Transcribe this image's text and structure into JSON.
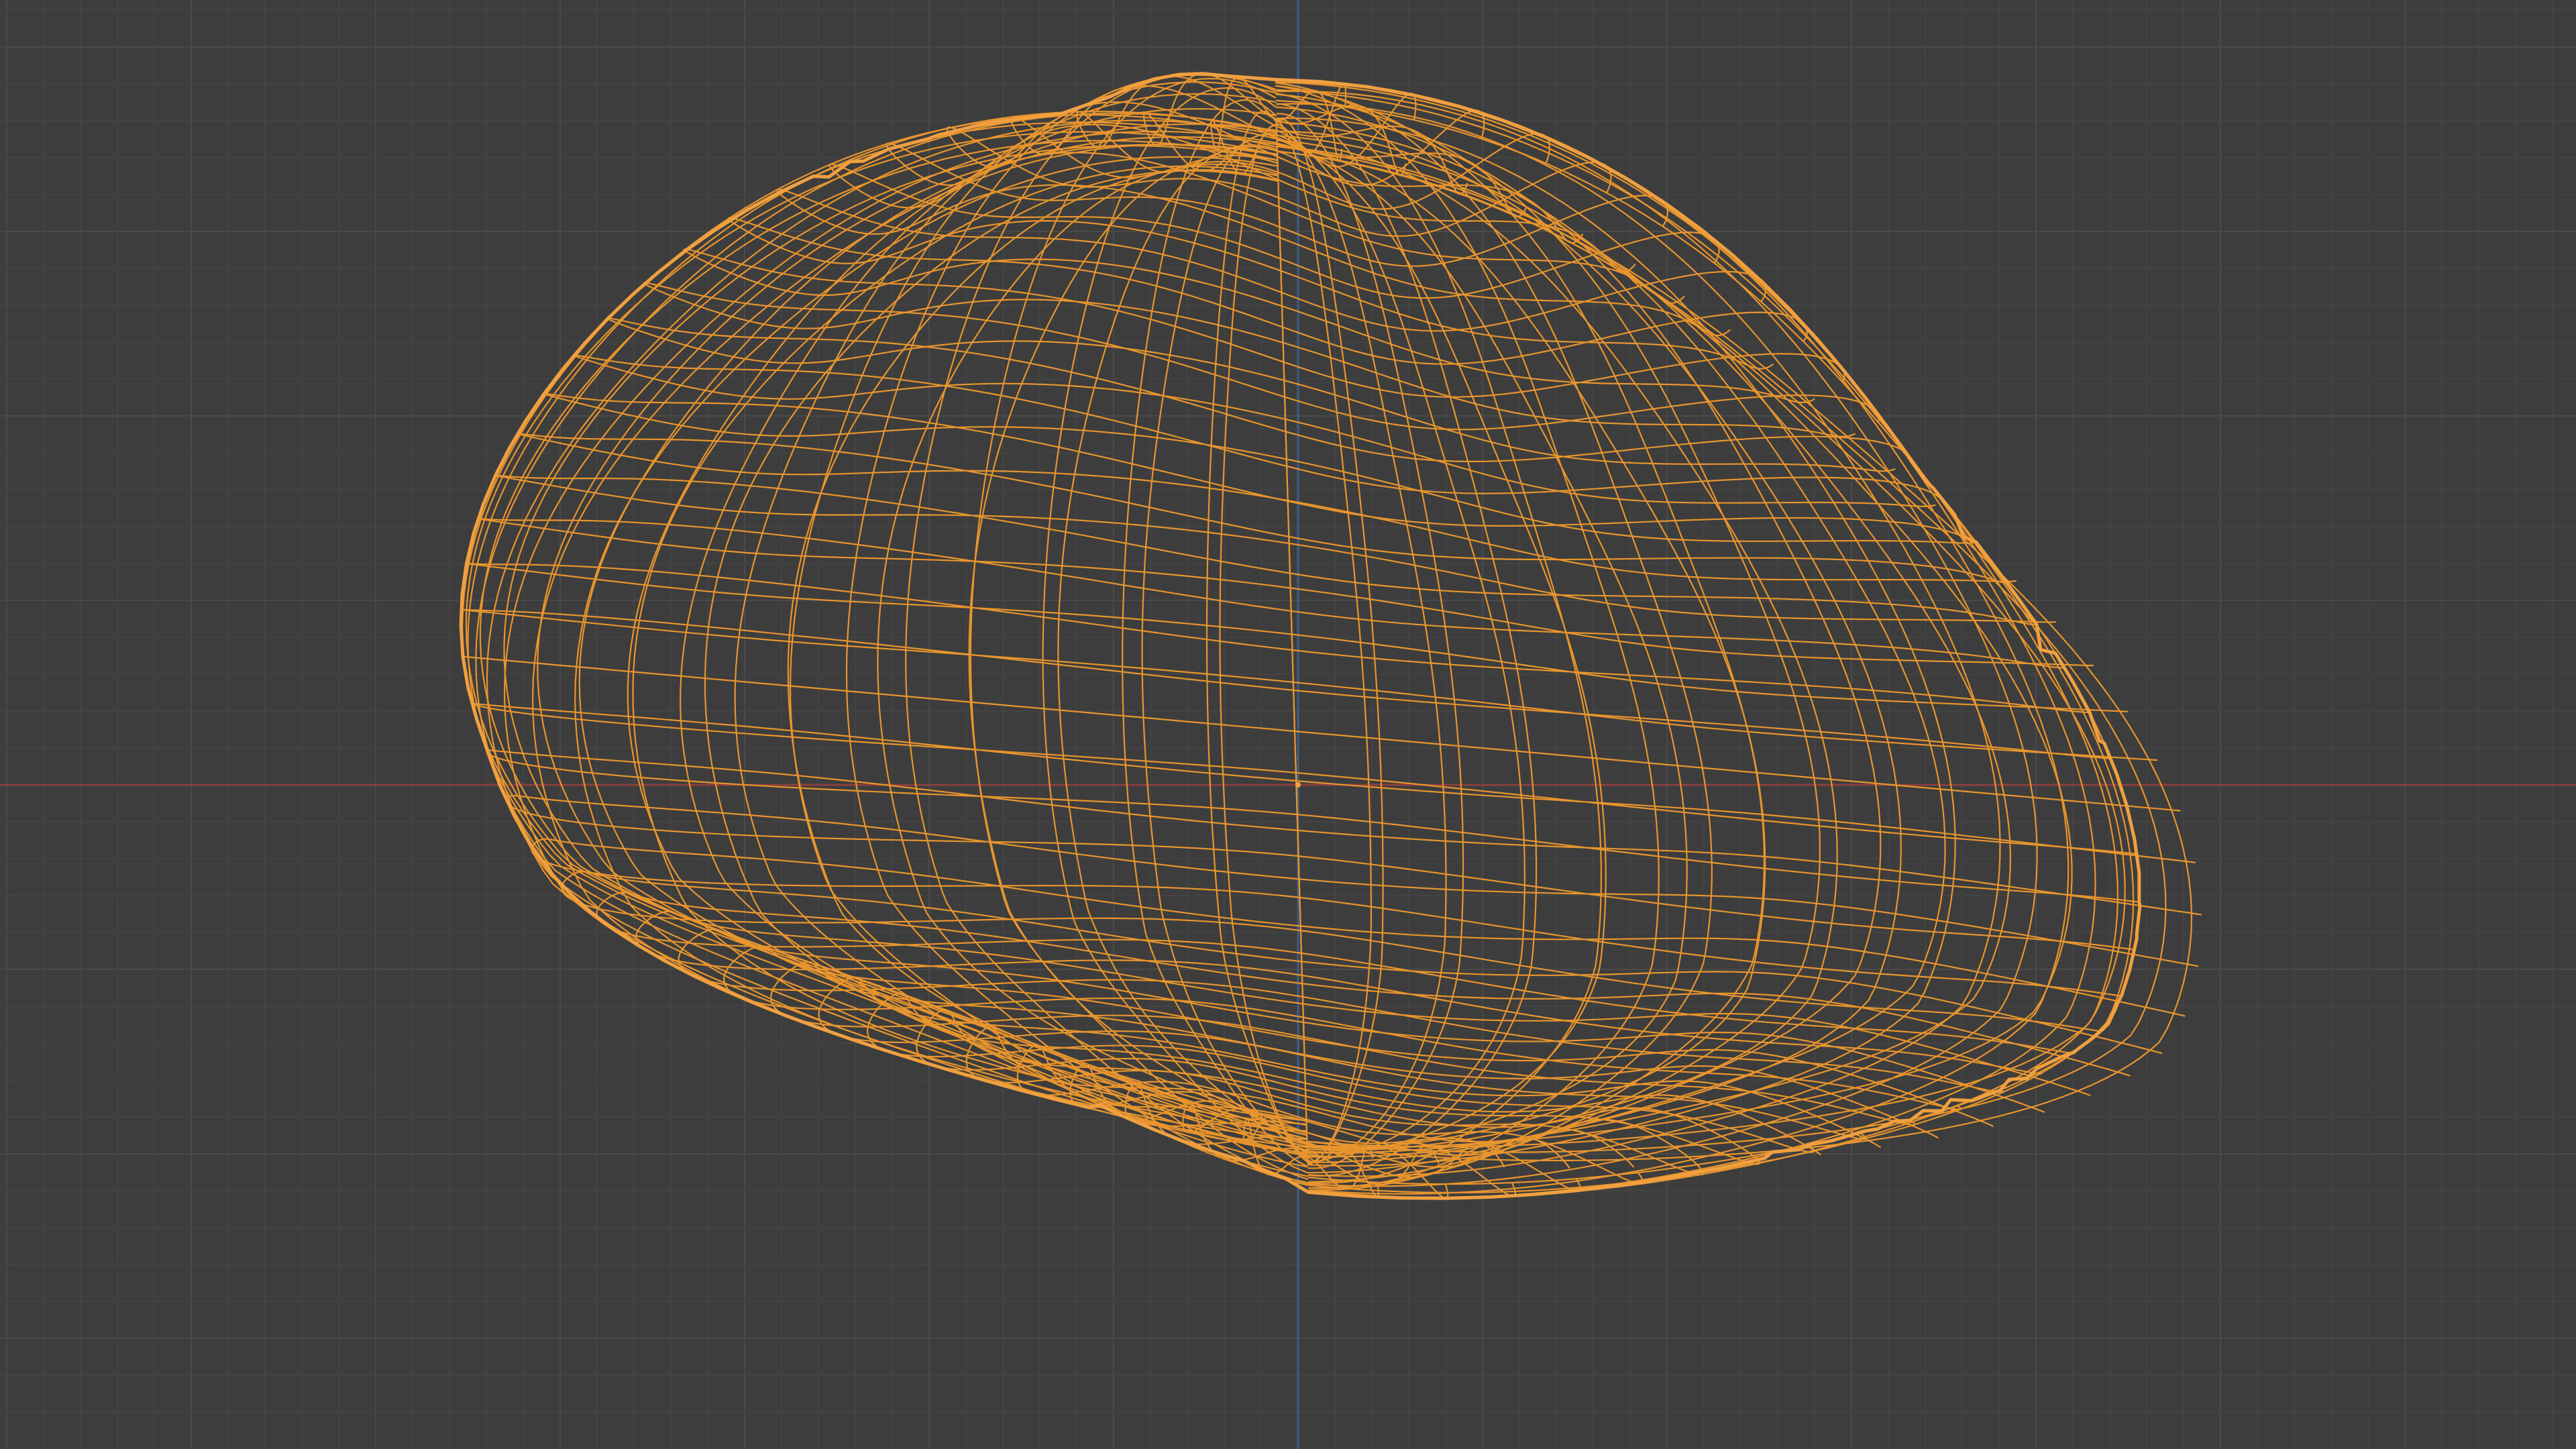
{
  "viewport": {
    "type": "3d-viewport",
    "view": "front-orthographic",
    "shading": "wireframe",
    "selection_state": "object selected",
    "colors": {
      "background": "#3d3d3d",
      "grid_minor": "#434343",
      "grid_major": "#4a4a4a",
      "x_axis": "#8a3f3f",
      "z_axis": "#3f5e86",
      "wire_selected": "#e8952e",
      "wire_outline": "#f0a040",
      "origin_point": "#f2a13c"
    },
    "object": {
      "kind": "mesh",
      "description_shape": "rock / pebble"
    }
  }
}
